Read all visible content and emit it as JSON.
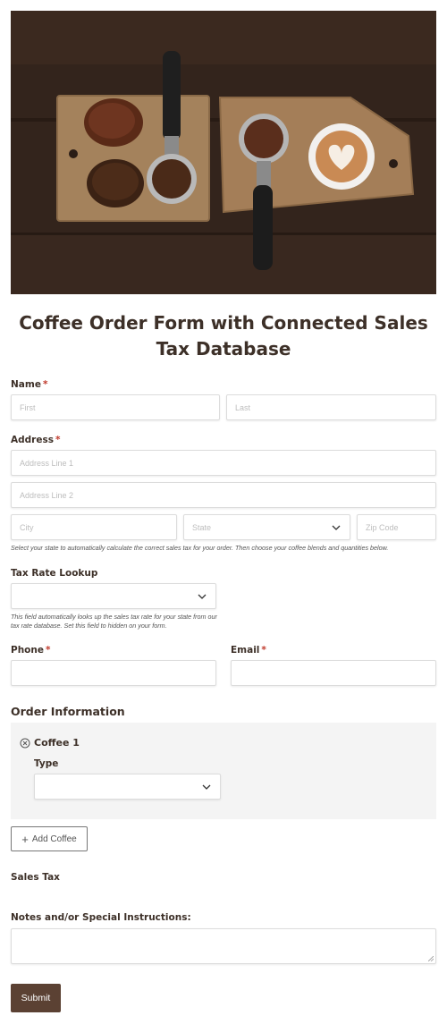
{
  "form": {
    "title": "Coffee Order Form with Connected Sales Tax Database"
  },
  "name": {
    "label": "Name",
    "required_mark": "*",
    "first_placeholder": "First",
    "last_placeholder": "Last"
  },
  "address": {
    "label": "Address",
    "required_mark": "*",
    "line1_placeholder": "Address Line 1",
    "line2_placeholder": "Address Line 2",
    "city_placeholder": "City",
    "state_placeholder": "State",
    "zip_placeholder": "Zip Code",
    "help": "Select your state to automatically calculate the correct sales tax for your order. Then choose your coffee blends and quantities below."
  },
  "tax_lookup": {
    "label": "Tax Rate Lookup",
    "value": "",
    "help": "This field automatically looks up the sales tax rate for your state from our tax rate database. Set this field to hidden on your form."
  },
  "phone": {
    "label": "Phone",
    "required_mark": "*"
  },
  "email": {
    "label": "Email",
    "required_mark": "*"
  },
  "order": {
    "section_title": "Order Information",
    "item_title": "Coffee 1",
    "type_label": "Type",
    "type_value": "",
    "add_label": "Add Coffee"
  },
  "sales_tax": {
    "label": "Sales Tax"
  },
  "notes": {
    "label": "Notes and/or Special Instructions:"
  },
  "submit": {
    "label": "Submit"
  },
  "colors": {
    "submit_bg": "#5b4133",
    "required": "#c0392b",
    "repeater_bg": "#f4f4f4"
  },
  "icons": [
    "chevron-down-icon",
    "remove-circle-icon",
    "plus-icon",
    "resize-grip-icon"
  ]
}
